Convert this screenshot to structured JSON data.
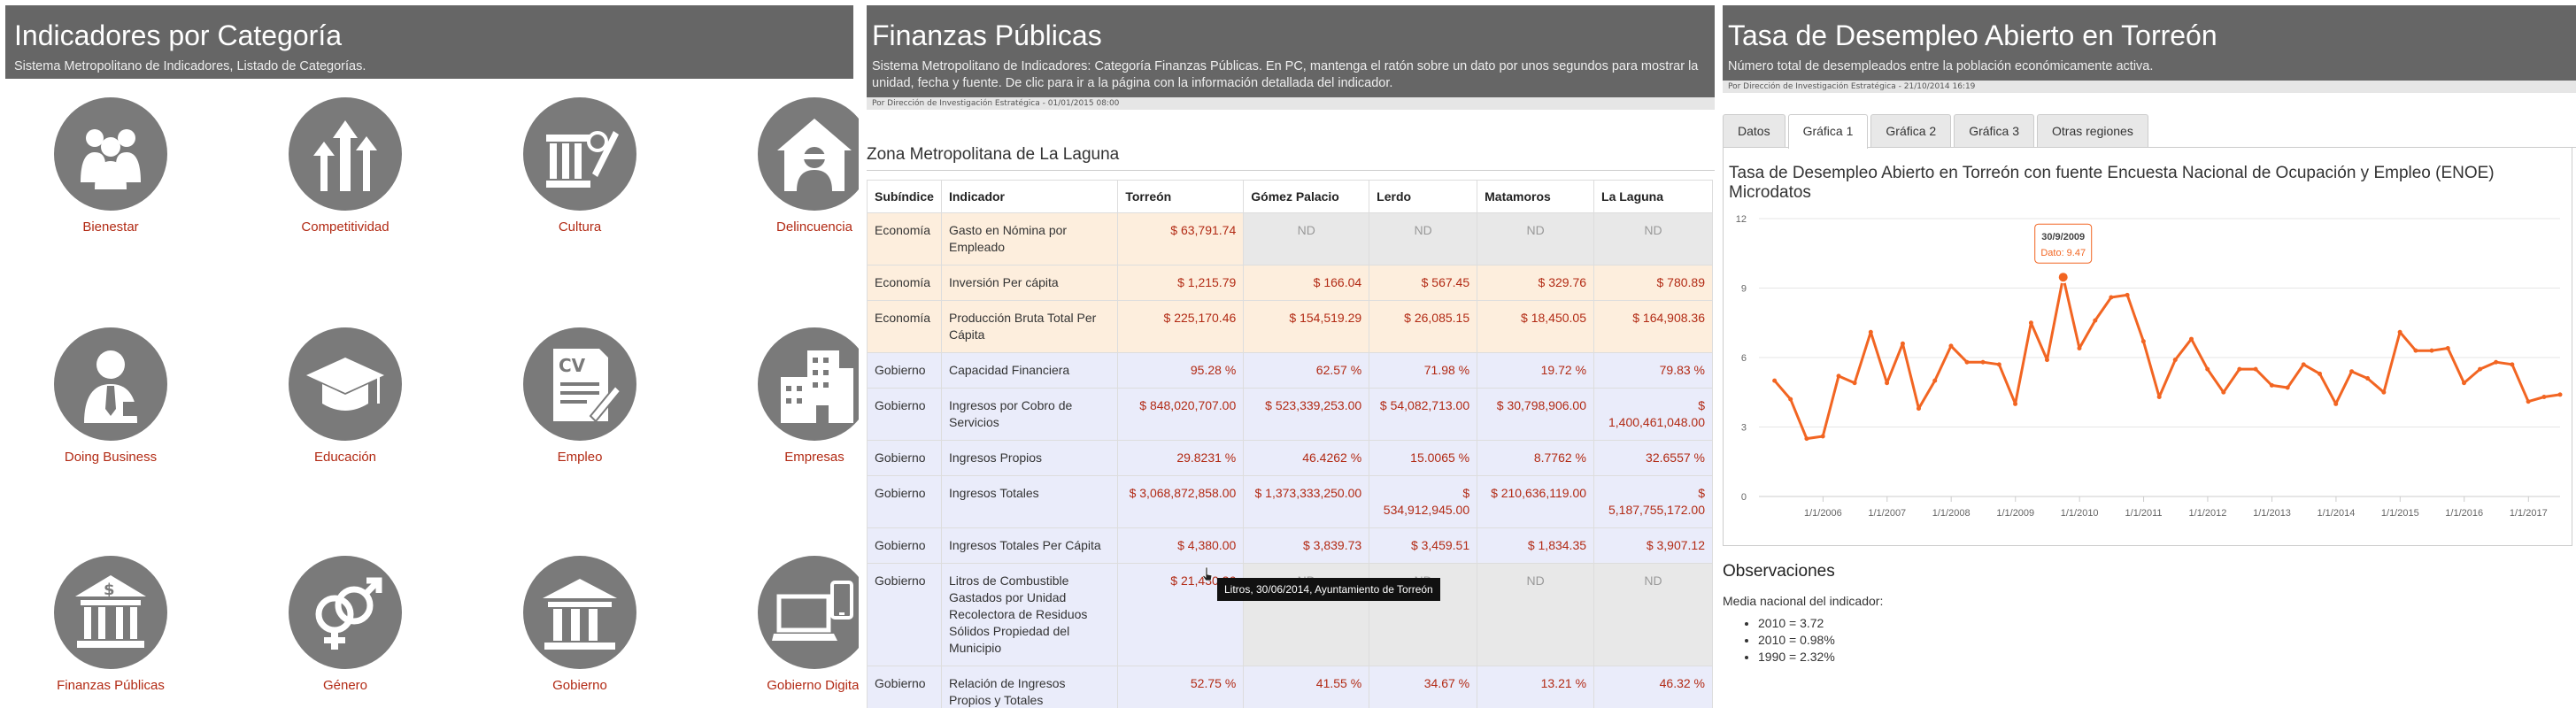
{
  "panel1": {
    "title": "Indicadores por Categoría",
    "subtitle": "Sistema Metropolitano de Indicadores, Listado de Categorías.",
    "categories": [
      {
        "label": "Bienestar",
        "icon": "people-group-icon"
      },
      {
        "label": "Competitividad",
        "icon": "arrows-up-icon"
      },
      {
        "label": "Cultura",
        "icon": "columns-pen-icon"
      },
      {
        "label": "Delincuencia",
        "icon": "thief-house-icon"
      },
      {
        "label": "Doing Business",
        "icon": "businessman-icon"
      },
      {
        "label": "Educación",
        "icon": "graduation-cap-icon"
      },
      {
        "label": "Empleo",
        "icon": "cv-document-icon"
      },
      {
        "label": "Empresas",
        "icon": "buildings-icon"
      },
      {
        "label": "Finanzas Públicas",
        "icon": "bank-dollar-icon"
      },
      {
        "label": "Género",
        "icon": "gender-symbols-icon"
      },
      {
        "label": "Gobierno",
        "icon": "government-building-icon"
      },
      {
        "label": "Gobierno Digital",
        "icon": "laptop-phone-icon"
      }
    ]
  },
  "panel2": {
    "title": "Finanzas Públicas",
    "subtitle": "Sistema Metropolitano de Indicadores: Categoría Finanzas Públicas. En PC, mantenga el ratón sobre un dato por unos segundos para mostrar la unidad, fecha y fuente. De clic para ir a la página con la información detallada del indicador.",
    "byline": "Por Dirección de Investigación Estratégica - 01/01/2015 08:00",
    "section": "Zona Metropolitana de La Laguna",
    "headers": [
      "Subíndice",
      "Indicador",
      "Torreón",
      "Gómez Palacio",
      "Lerdo",
      "Matamoros",
      "La Laguna"
    ],
    "rows": [
      {
        "group": "eco",
        "cells": [
          "Economía",
          "Gasto en Nómina por Empleado",
          "$ 63,791.74",
          "ND",
          "ND",
          "ND",
          "ND"
        ]
      },
      {
        "group": "eco",
        "cells": [
          "Economía",
          "Inversión Per cápita",
          "$ 1,215.79",
          "$ 166.04",
          "$ 567.45",
          "$ 329.76",
          "$ 780.89"
        ]
      },
      {
        "group": "eco",
        "cells": [
          "Economía",
          "Producción Bruta Total Per Cápita",
          "$ 225,170.46",
          "$ 154,519.29",
          "$ 26,085.15",
          "$ 18,450.05",
          "$ 164,908.36"
        ]
      },
      {
        "group": "gob",
        "cells": [
          "Gobierno",
          "Capacidad Financiera",
          "95.28 %",
          "62.57 %",
          "71.98 %",
          "19.72 %",
          "79.83 %"
        ]
      },
      {
        "group": "gob",
        "cells": [
          "Gobierno",
          "Ingresos por Cobro de Servicios",
          "$ 848,020,707.00",
          "$ 523,339,253.00",
          "$ 54,082,713.00",
          "$ 30,798,906.00",
          "$ 1,400,461,048.00"
        ]
      },
      {
        "group": "gob",
        "cells": [
          "Gobierno",
          "Ingresos Propios",
          "29.8231 %",
          "46.4262 %",
          "15.0065 %",
          "8.7762 %",
          "32.6557 %"
        ]
      },
      {
        "group": "gob",
        "cells": [
          "Gobierno",
          "Ingresos Totales",
          "$ 3,068,872,858.00",
          "$ 1,373,333,250.00",
          "$ 534,912,945.00",
          "$ 210,636,119.00",
          "$ 5,187,755,172.00"
        ]
      },
      {
        "group": "gob",
        "cells": [
          "Gobierno",
          "Ingresos Totales Per Cápita",
          "$ 4,380.00",
          "$ 3,839.73",
          "$ 3,459.51",
          "$ 1,834.35",
          "$ 3,907.12"
        ]
      },
      {
        "group": "gob",
        "cells": [
          "Gobierno",
          "Litros de Combustible Gastados por Unidad Recolectora de Residuos Sólidos Propiedad del Municipio",
          "$ 21,430.36",
          "ND",
          "ND",
          "ND",
          "ND"
        ]
      },
      {
        "group": "gob",
        "cells": [
          "Gobierno",
          "Relación de Ingresos Propios y Totales",
          "52.75 %",
          "41.55 %",
          "34.67 %",
          "13.21 %",
          "46.32 %"
        ]
      }
    ],
    "tooltip": "Litros, 30/06/2014, Ayuntamiento de Torreón"
  },
  "panel3": {
    "title": "Tasa de Desempleo Abierto en Torreón",
    "subtitle": "Número total de desempleados entre la población económicamente activa.",
    "byline": "Por Dirección de Investigación Estratégica - 21/10/2014 16:19",
    "tabs": [
      "Datos",
      "Gráfica 1",
      "Gráfica 2",
      "Gráfica 3",
      "Otras regiones"
    ],
    "active_tab": 1,
    "chart_title": "Tasa de Desempleo Abierto en Torreón con fuente Encuesta Nacional de Ocupación y Empleo (ENOE) Microdatos",
    "tooltip_date": "30/9/2009",
    "tooltip_value": "Dato: 9.47",
    "observations_title": "Observaciones",
    "observations_text": "Media nacional del indicador:",
    "observations": [
      "2010 = 3.72",
      "2010 = 0.98%",
      "1990 = 2.32%"
    ]
  },
  "colors": {
    "header": "#666666",
    "accent": "#b22a14",
    "line": "#f26522"
  },
  "chart_data": {
    "type": "line",
    "title": "Tasa de Desempleo Abierto en Torreón con fuente Encuesta Nacional de Ocupación y Empleo (ENOE) Microdatos",
    "x_tick_labels": [
      "1/1/2006",
      "1/1/2007",
      "1/1/2008",
      "1/1/2009",
      "1/1/2010",
      "1/1/2011",
      "1/1/2012",
      "1/1/2013",
      "1/1/2014",
      "1/1/2015",
      "1/1/2016",
      "1/1/2017"
    ],
    "y_ticks": [
      0,
      3,
      6,
      9,
      12
    ],
    "ylim": [
      0,
      12
    ],
    "xlim": [
      "2005-01-01",
      "2017-06-30"
    ],
    "grid": true,
    "series": [
      {
        "x": [
          "2005-03-31",
          "2005-06-30",
          "2005-09-30",
          "2005-12-31",
          "2006-03-31",
          "2006-06-30",
          "2006-09-30",
          "2006-12-31",
          "2007-03-31",
          "2007-06-30",
          "2007-09-30",
          "2007-12-31",
          "2008-03-31",
          "2008-06-30",
          "2008-09-30",
          "2008-12-31",
          "2009-03-31",
          "2009-06-30",
          "2009-09-30",
          "2009-12-31",
          "2010-03-31",
          "2010-06-30",
          "2010-09-30",
          "2010-12-31",
          "2011-03-31",
          "2011-06-30",
          "2011-09-30",
          "2011-12-31",
          "2012-03-31",
          "2012-06-30",
          "2012-09-30",
          "2012-12-31",
          "2013-03-31",
          "2013-06-30",
          "2013-09-30",
          "2013-12-31",
          "2014-03-31",
          "2014-06-30",
          "2014-09-30",
          "2014-12-31",
          "2015-03-31",
          "2015-06-30",
          "2015-09-30",
          "2015-12-31",
          "2016-03-31",
          "2016-06-30",
          "2016-09-30",
          "2016-12-31",
          "2017-03-31",
          "2017-06-30"
        ],
        "values": [
          5.0,
          4.2,
          2.5,
          2.6,
          5.2,
          4.9,
          7.1,
          4.9,
          6.6,
          3.8,
          5.0,
          6.5,
          5.8,
          5.8,
          5.7,
          4.0,
          7.5,
          5.9,
          9.47,
          6.4,
          7.6,
          8.6,
          8.7,
          6.7,
          4.3,
          5.9,
          6.8,
          5.5,
          4.5,
          5.5,
          5.5,
          4.8,
          4.7,
          5.7,
          5.3,
          4.0,
          5.4,
          5.1,
          4.5,
          7.1,
          6.3,
          6.3,
          6.4,
          4.9,
          5.5,
          5.8,
          5.7,
          4.1,
          4.3,
          4.4
        ]
      }
    ]
  }
}
